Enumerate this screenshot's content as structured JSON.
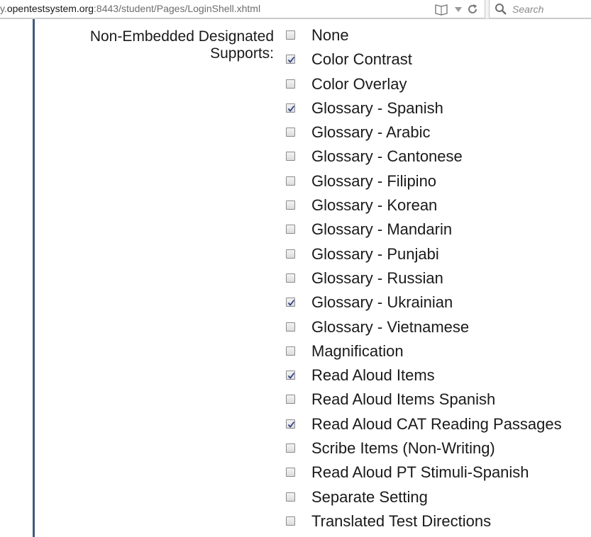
{
  "browser": {
    "url_prefix": "y.",
    "url_domain": "opentestsystem.org",
    "url_rest": ":8443/student/Pages/LoginShell.xhtml",
    "search_placeholder": "Search"
  },
  "form": {
    "field_label_line1": "Non-Embedded Designated",
    "field_label_line2": "Supports:",
    "options": [
      {
        "label": "None",
        "checked": false
      },
      {
        "label": "Color Contrast",
        "checked": true
      },
      {
        "label": "Color Overlay",
        "checked": false
      },
      {
        "label": "Glossary - Spanish",
        "checked": true
      },
      {
        "label": "Glossary - Arabic",
        "checked": false
      },
      {
        "label": "Glossary - Cantonese",
        "checked": false
      },
      {
        "label": "Glossary - Filipino",
        "checked": false
      },
      {
        "label": "Glossary - Korean",
        "checked": false
      },
      {
        "label": "Glossary - Mandarin",
        "checked": false
      },
      {
        "label": "Glossary - Punjabi",
        "checked": false
      },
      {
        "label": "Glossary - Russian",
        "checked": false
      },
      {
        "label": "Glossary - Ukrainian",
        "checked": true
      },
      {
        "label": "Glossary - Vietnamese",
        "checked": false
      },
      {
        "label": "Magnification",
        "checked": false
      },
      {
        "label": "Read Aloud Items",
        "checked": true
      },
      {
        "label": "Read Aloud Items Spanish",
        "checked": false
      },
      {
        "label": "Read Aloud CAT Reading Passages",
        "checked": true
      },
      {
        "label": "Scribe Items (Non-Writing)",
        "checked": false
      },
      {
        "label": "Read Aloud PT Stimuli-Spanish",
        "checked": false
      },
      {
        "label": "Separate Setting",
        "checked": false
      },
      {
        "label": "Translated Test Directions",
        "checked": false
      }
    ]
  }
}
